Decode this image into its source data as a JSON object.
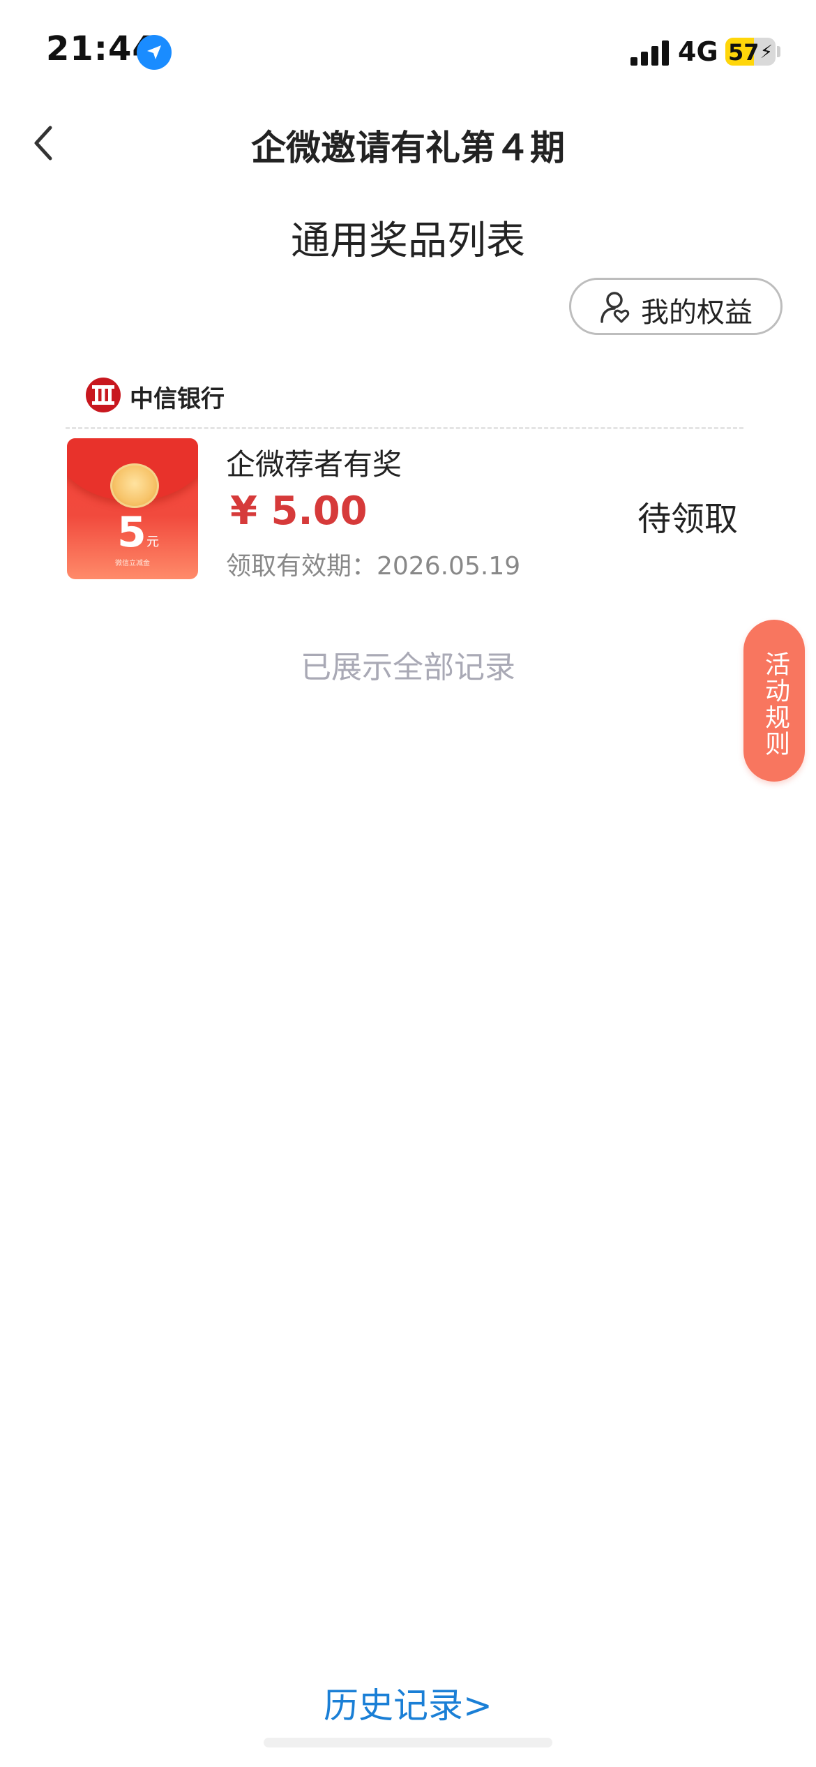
{
  "status_bar": {
    "time": "21:44",
    "network": "4G",
    "battery_percent": "57",
    "battery_level": 0.57,
    "charging_symbol": "⚡",
    "icons": [
      "location-arrow-icon",
      "signal-bars-icon",
      "battery-icon"
    ]
  },
  "nav": {
    "back_icon": "chevron-left-icon",
    "title": "企微邀请有礼第４期"
  },
  "section": {
    "title": "通用奖品列表"
  },
  "benefits_button": {
    "icon": "user-heart-icon",
    "label": "我的权益"
  },
  "bank": {
    "logo_icon": "citic-bank-logo",
    "name": "中信银行"
  },
  "prize": {
    "image_amount": "5",
    "image_unit": "元",
    "image_caption": "微信立减金",
    "name": "企微荐者有奖",
    "price": "¥ 5.00",
    "validity": "领取有效期：2026.05.19",
    "status": "待领取"
  },
  "end_note": "已展示全部记录",
  "rules_tab": {
    "label": "活动规则"
  },
  "history_link": "历史记录>",
  "colors": {
    "price_red": "#d63a3a",
    "link_blue": "#1a7fd6",
    "rules_tab_bg": "#f8765f",
    "battery_yellow": "#ffd60a",
    "location_blue": "#1a8cff"
  }
}
